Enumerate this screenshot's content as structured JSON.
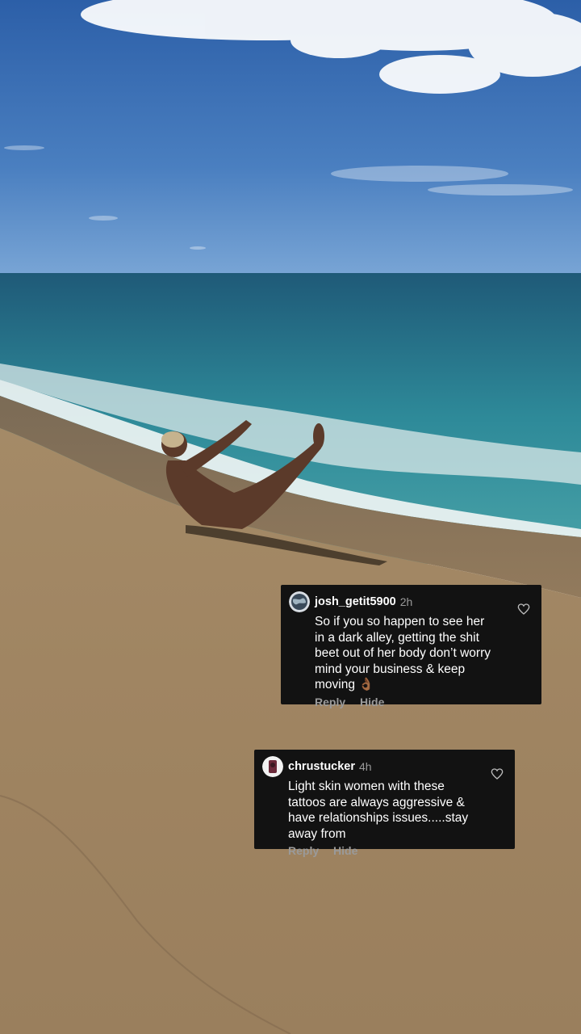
{
  "comments": [
    {
      "username": "josh_getit5900",
      "time": "2h",
      "text": "So if you so happen to see her in a dark alley, getting the shit beet out of her body don’t worry mind your business & keep moving 👌🏾",
      "reply_label": "Reply",
      "hide_label": "Hide",
      "avatar_icon": "globe-avatar"
    },
    {
      "username": "chrustucker",
      "time": "4h",
      "text": "Light skin women with these tattoos are always aggressive & have relationships issues.....stay away from",
      "reply_label": "Reply",
      "hide_label": "Hide",
      "avatar_icon": "portrait-avatar"
    }
  ],
  "colors": {
    "comment_bg": "#121212",
    "meta_gray": "#9a9a9a"
  }
}
